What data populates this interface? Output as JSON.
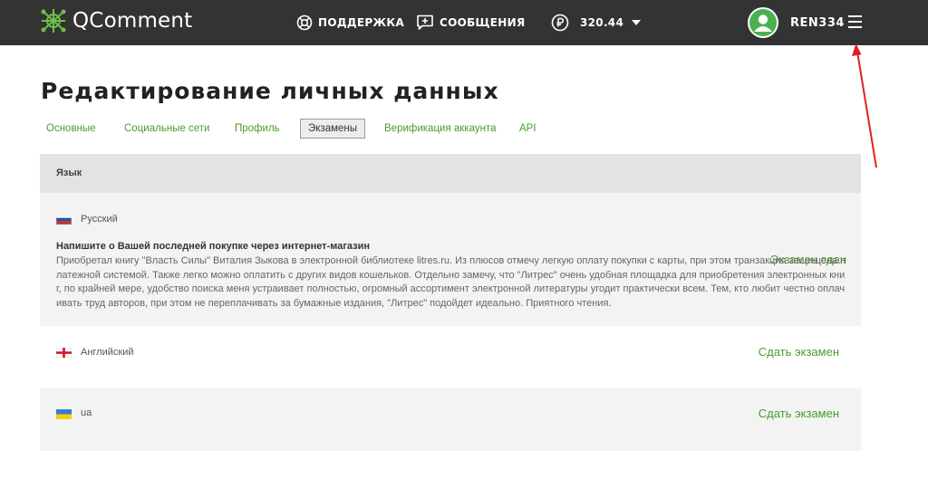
{
  "header": {
    "logo_text": "QComment",
    "support_label": "ПОДДЕРЖКА",
    "messages_label": "СООБЩЕНИЯ",
    "balance": "320.44",
    "username": "REN334",
    "colors": {
      "bar": "#333333",
      "accent": "#4a9a2c",
      "logo": "#6cc04a"
    },
    "icons": [
      "qcomment-logo-icon",
      "lifebuoy-icon",
      "message-plus-icon",
      "ruble-icon",
      "caret-down-icon",
      "user-avatar-icon",
      "menu-icon"
    ]
  },
  "page": {
    "title": "Редактирование личных данных"
  },
  "tabs": [
    {
      "label": "Основные",
      "active": false
    },
    {
      "label": "Социальные сети",
      "active": false
    },
    {
      "label": "Профиль",
      "active": false
    },
    {
      "label": "Экзамены",
      "active": true
    },
    {
      "label": "Верификация аккаунта",
      "active": false
    },
    {
      "label": "API",
      "active": false
    }
  ],
  "table": {
    "header": "Язык",
    "rows": [
      {
        "language": "Русский",
        "flag": "russia-flag-icon",
        "status": "Экзамен сдан",
        "answer_title": "Напишите о Вашей последней покупке через интернет-магазин",
        "answer_text": "Приобретал книгу \"Власть Силы\" Виталия Зыкова в электронной библиотеке litres.ru. Из плюсов отмечу легкую оплату покупки с карты, при этом транзакция защищена платежной системой. Также легко можно оплатить с других видов кошельков. Отдельно замечу, что \"Литрес\" очень удобная площадка для приобретения электронных книг, по крайней мере, удобство поиска меня устраивает полностью, огромный ассортимент электронной литературы угодит практически всем. Тем, кто любит честно оплачивать труд авторов, при этом не переплачивать за бумажные издания, \"Литрес\" подойдет идеально. Приятного чтения."
      },
      {
        "language": "Английский",
        "flag": "england-flag-icon",
        "status": "Сдать экзамен"
      },
      {
        "language": "ua",
        "flag": "ukraine-flag-icon",
        "status": "Сдать экзамен"
      }
    ]
  },
  "annotation": {
    "arrow_color": "#e02020"
  }
}
